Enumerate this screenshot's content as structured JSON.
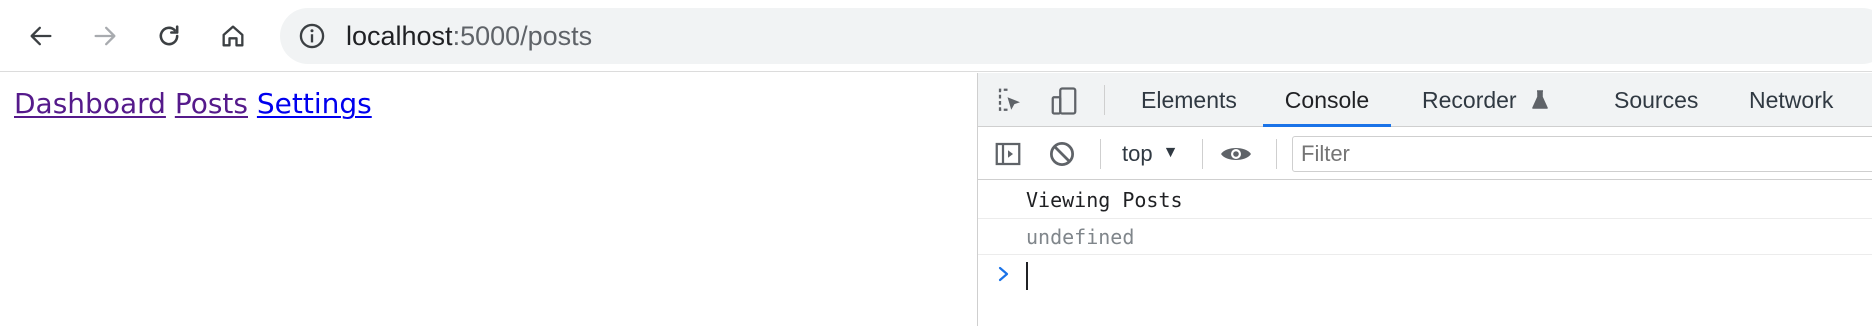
{
  "browser": {
    "url_host": "localhost",
    "url_rest": ":5000/posts",
    "icons": {
      "back": "arrow-left-icon",
      "forward": "arrow-right-icon",
      "reload": "reload-icon",
      "home": "home-icon",
      "site_info": "info-icon"
    }
  },
  "page": {
    "links": [
      {
        "label": "Dashboard",
        "visited": true
      },
      {
        "label": "Posts",
        "visited": true
      },
      {
        "label": "Settings",
        "visited": false
      }
    ]
  },
  "devtools": {
    "tabs": [
      {
        "label": "Elements",
        "active": false
      },
      {
        "label": "Console",
        "active": true
      },
      {
        "label": "Recorder",
        "active": false,
        "icon": "flask-icon"
      },
      {
        "label": "Sources",
        "active": false
      },
      {
        "label": "Network",
        "active": false
      }
    ],
    "console": {
      "context": "top",
      "filter_placeholder": "Filter",
      "messages": [
        {
          "text": "Viewing Posts",
          "type": "log"
        },
        {
          "text": "undefined",
          "type": "result"
        }
      ]
    }
  },
  "colors": {
    "visited_link": "#551a8b",
    "link": "#0000ee",
    "active_tab_underline": "#1a73e8",
    "omnibox_bg": "#f1f3f4"
  }
}
